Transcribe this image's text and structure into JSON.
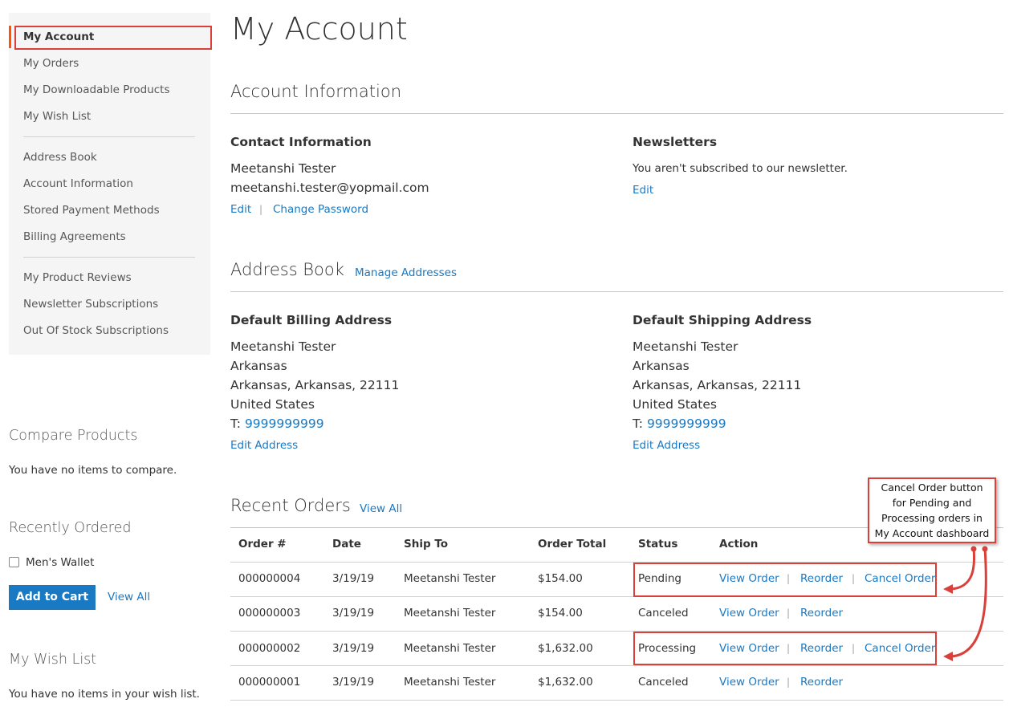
{
  "sidebar": {
    "nav": [
      {
        "label": "My Account",
        "current": true
      },
      {
        "label": "My Orders"
      },
      {
        "label": "My Downloadable Products"
      },
      {
        "label": "My Wish List"
      },
      {
        "label": "Address Book"
      },
      {
        "label": "Account Information"
      },
      {
        "label": "Stored Payment Methods"
      },
      {
        "label": "Billing Agreements"
      },
      {
        "label": "My Product Reviews"
      },
      {
        "label": "Newsletter Subscriptions"
      },
      {
        "label": "Out Of Stock Subscriptions"
      }
    ],
    "compare": {
      "title": "Compare Products",
      "empty": "You have no items to compare."
    },
    "recent": {
      "title": "Recently Ordered",
      "item": "Men's Wallet",
      "add_to_cart": "Add to Cart",
      "view_all": "View All"
    },
    "wishlist": {
      "title": "My Wish List",
      "empty": "You have no items in your wish list."
    }
  },
  "page": {
    "title": "My Account"
  },
  "account_info": {
    "title": "Account Information",
    "contact": {
      "title": "Contact Information",
      "name": "Meetanshi Tester",
      "email": "meetanshi.tester@yopmail.com",
      "edit": "Edit",
      "change_password": "Change Password"
    },
    "newsletters": {
      "title": "Newsletters",
      "text": "You aren't subscribed to our newsletter.",
      "edit": "Edit"
    }
  },
  "address_book": {
    "title": "Address Book",
    "manage": "Manage Addresses",
    "billing": {
      "title": "Default Billing Address",
      "name": "Meetanshi Tester",
      "line1": "Arkansas",
      "line2": "Arkansas, Arkansas, 22111",
      "country": "United States",
      "phone_prefix": "T:",
      "phone": "9999999999",
      "edit": "Edit Address"
    },
    "shipping": {
      "title": "Default Shipping Address",
      "name": "Meetanshi Tester",
      "line1": "Arkansas",
      "line2": "Arkansas, Arkansas, 22111",
      "country": "United States",
      "phone_prefix": "T:",
      "phone": "9999999999",
      "edit": "Edit Address"
    }
  },
  "recent_orders": {
    "title": "Recent Orders",
    "view_all": "View All",
    "columns": [
      "Order #",
      "Date",
      "Ship To",
      "Order Total",
      "Status",
      "Action"
    ],
    "rows": [
      {
        "order": "000000004",
        "date": "3/19/19",
        "ship_to": "Meetanshi Tester",
        "total": "$154.00",
        "status": "Pending",
        "actions": [
          "View Order",
          "Reorder",
          "Cancel Order"
        ]
      },
      {
        "order": "000000003",
        "date": "3/19/19",
        "ship_to": "Meetanshi Tester",
        "total": "$154.00",
        "status": "Canceled",
        "actions": [
          "View Order",
          "Reorder"
        ]
      },
      {
        "order": "000000002",
        "date": "3/19/19",
        "ship_to": "Meetanshi Tester",
        "total": "$1,632.00",
        "status": "Processing",
        "actions": [
          "View Order",
          "Reorder",
          "Cancel Order"
        ]
      },
      {
        "order": "000000001",
        "date": "3/19/19",
        "ship_to": "Meetanshi Tester",
        "total": "$1,632.00",
        "status": "Canceled",
        "actions": [
          "View Order",
          "Reorder"
        ]
      }
    ],
    "separator": "|"
  },
  "annotation": {
    "lines": [
      "Cancel Order button",
      "for Pending and",
      "Processing orders in",
      "My Account dashboard"
    ]
  },
  "colors": {
    "link": "#1979c3",
    "annotation": "#d9403a",
    "nav_accent": "#ff5501",
    "button": "#1979c3"
  }
}
